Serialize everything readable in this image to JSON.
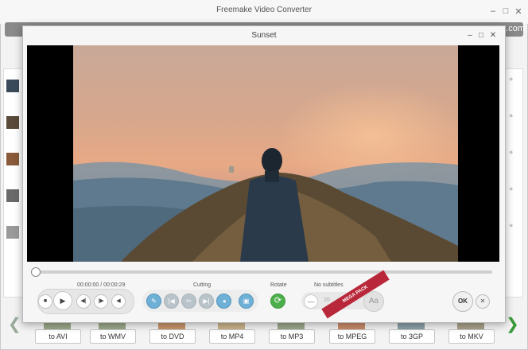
{
  "main_window": {
    "title": "Freemake Video Converter",
    "brand_suffix": ".com",
    "formats": [
      {
        "label": "to AVI"
      },
      {
        "label": "to WMV"
      },
      {
        "label": "to DVD"
      },
      {
        "label": "to MP4"
      },
      {
        "label": "to MP3"
      },
      {
        "label": "to MPEG"
      },
      {
        "label": "to 3GP"
      },
      {
        "label": "to MKV"
      }
    ]
  },
  "player": {
    "title": "Sunset",
    "time": "00:00:00 / 00:00:29",
    "cutting_label": "Cutting",
    "rotate_label": "Rotate",
    "subtitles_label": "No subtitles",
    "subtitle_number": "20",
    "mega_pack_label": "MEGA PACK",
    "font_button_label": "Aa",
    "ok_label": "OK",
    "playback_progress": 0.0
  },
  "colors": {
    "accent_blue": "#6fb0d6",
    "rotate_green": "#4caf4c",
    "mega_red": "#b9283a"
  }
}
